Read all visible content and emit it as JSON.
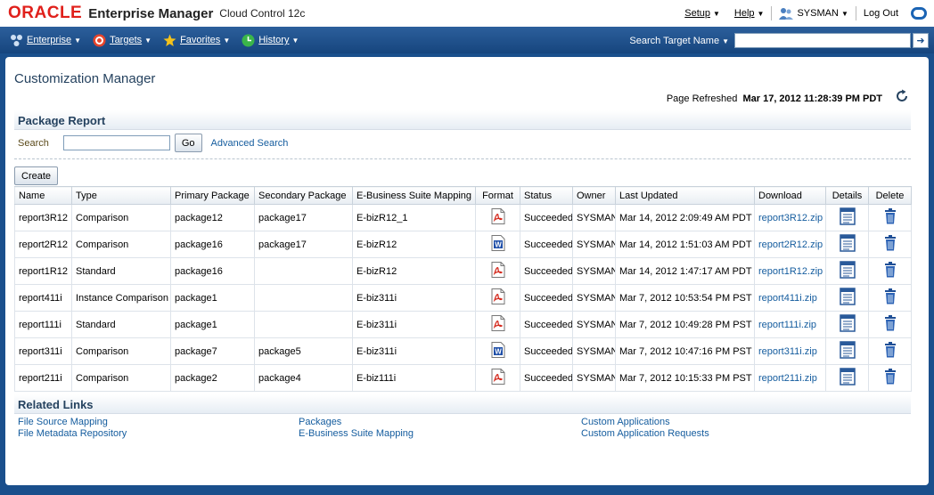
{
  "brand": {
    "logo": "ORACLE",
    "product": "Enterprise Manager",
    "version": "Cloud Control 12c",
    "menus": {
      "setup": "Setup",
      "help": "Help",
      "user": "SYSMAN",
      "logout": "Log Out"
    }
  },
  "nav": {
    "items": [
      "Enterprise",
      "Targets",
      "Favorites",
      "History"
    ],
    "search_label": "Search Target Name",
    "search_value": ""
  },
  "page": {
    "title": "Customization Manager",
    "refreshed_label": "Page Refreshed",
    "refreshed_value": "Mar 17, 2012 11:28:39 PM PDT"
  },
  "report": {
    "header": "Package Report",
    "search_label": "Search",
    "search_value": "",
    "go_label": "Go",
    "advanced_search": "Advanced Search",
    "create_label": "Create",
    "columns": [
      "Name",
      "Type",
      "Primary Package",
      "Secondary Package",
      "E-Business Suite Mapping",
      "Format",
      "Status",
      "Owner",
      "Last Updated",
      "Download",
      "Details",
      "Delete"
    ],
    "rows": [
      {
        "name": "report3R12",
        "type": "Comparison",
        "primary": "package12",
        "secondary": "package17",
        "mapping": "E-bizR12_1",
        "format": "pdf",
        "status": "Succeeded",
        "owner": "SYSMAN",
        "updated": "Mar 14, 2012 2:09:49 AM PDT",
        "download": "report3R12.zip"
      },
      {
        "name": "report2R12",
        "type": "Comparison",
        "primary": "package16",
        "secondary": "package17",
        "mapping": "E-bizR12",
        "format": "word",
        "status": "Succeeded",
        "owner": "SYSMAN",
        "updated": "Mar 14, 2012 1:51:03 AM PDT",
        "download": "report2R12.zip"
      },
      {
        "name": "report1R12",
        "type": "Standard",
        "primary": "package16",
        "secondary": "",
        "mapping": "E-bizR12",
        "format": "pdf",
        "status": "Succeeded",
        "owner": "SYSMAN",
        "updated": "Mar 14, 2012 1:47:17 AM PDT",
        "download": "report1R12.zip"
      },
      {
        "name": "report411i",
        "type": "Instance Comparison",
        "primary": "package1",
        "secondary": "",
        "mapping": "E-biz311i",
        "format": "pdf",
        "status": "Succeeded",
        "owner": "SYSMAN",
        "updated": "Mar 7, 2012 10:53:54 PM PST",
        "download": "report411i.zip"
      },
      {
        "name": "report111i",
        "type": "Standard",
        "primary": "package1",
        "secondary": "",
        "mapping": "E-biz311i",
        "format": "pdf",
        "status": "Succeeded",
        "owner": "SYSMAN",
        "updated": "Mar 7, 2012 10:49:28 PM PST",
        "download": "report111i.zip"
      },
      {
        "name": "report311i",
        "type": "Comparison",
        "primary": "package7",
        "secondary": "package5",
        "mapping": "E-biz311i",
        "format": "word",
        "status": "Succeeded",
        "owner": "SYSMAN",
        "updated": "Mar 7, 2012 10:47:16 PM PST",
        "download": "report311i.zip"
      },
      {
        "name": "report211i",
        "type": "Comparison",
        "primary": "package2",
        "secondary": "package4",
        "mapping": "E-biz111i",
        "format": "pdf",
        "status": "Succeeded",
        "owner": "SYSMAN",
        "updated": "Mar 7, 2012 10:15:33 PM PST",
        "download": "report211i.zip"
      }
    ]
  },
  "related": {
    "header": "Related Links",
    "col1": [
      "File Source Mapping",
      "File Metadata Repository"
    ],
    "col2": [
      "Packages",
      "E-Business Suite Mapping"
    ],
    "col3": [
      "Custom Applications",
      "Custom Application Requests"
    ]
  },
  "colors": {
    "nav_blue": "#1a4f8c",
    "oracle_red": "#e0201b",
    "link_blue": "#145c9e",
    "title_blue": "#25425f"
  }
}
